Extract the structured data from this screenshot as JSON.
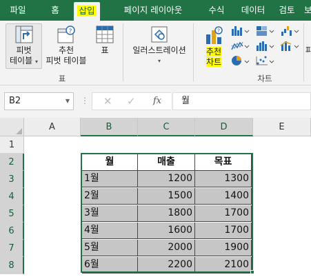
{
  "ribbon_tabs": [
    "파일",
    "홈",
    "삽입",
    "페이지 레이아웃",
    "수식",
    "데이터",
    "검토",
    "보"
  ],
  "active_tab": "삽입",
  "ribbon": {
    "pivot_table_line1": "피벗",
    "pivot_table_line2": "테이블",
    "recommended_pivot_line1": "추천",
    "recommended_pivot_line2": "피벗 테이블",
    "table_label": "표",
    "table_group_label": "표",
    "illustrations_label": "일러스트레이션",
    "recommended_chart_line1": "추천",
    "recommended_chart_line2": "차트",
    "chart_group_label": "차트",
    "edge_label": "파"
  },
  "formula_bar": {
    "name_box": "B2",
    "formula_value": "월",
    "fx_label": "fx",
    "cancel_glyph": "✕",
    "enter_glyph": "✓"
  },
  "columns": [
    "A",
    "B",
    "C",
    "D",
    "E"
  ],
  "rows": [
    "1",
    "2",
    "3",
    "4",
    "5",
    "6",
    "7",
    "8"
  ],
  "table": {
    "headers": [
      "월",
      "매출",
      "목표"
    ],
    "rows": [
      [
        "1월",
        "1200",
        "1300"
      ],
      [
        "2월",
        "1500",
        "1400"
      ],
      [
        "3월",
        "1800",
        "1700"
      ],
      [
        "4월",
        "1600",
        "1700"
      ],
      [
        "5월",
        "2000",
        "1900"
      ],
      [
        "6월",
        "2200",
        "2100"
      ]
    ]
  },
  "colors": {
    "accent": "#217346",
    "highlight": "#ffff00",
    "data_fill": "#c6c6c6"
  }
}
